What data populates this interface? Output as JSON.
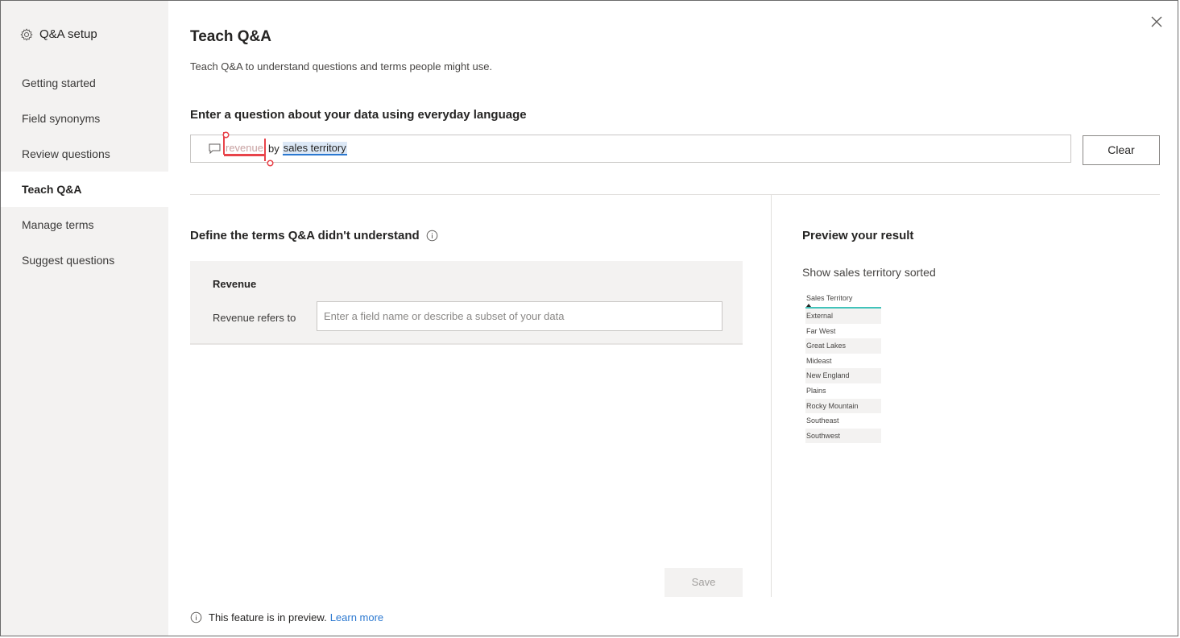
{
  "sidebar": {
    "header": "Q&A setup",
    "items": [
      {
        "label": "Getting started"
      },
      {
        "label": "Field synonyms"
      },
      {
        "label": "Review questions"
      },
      {
        "label": "Teach Q&A",
        "active": true
      },
      {
        "label": "Manage terms"
      },
      {
        "label": "Suggest questions"
      }
    ]
  },
  "main": {
    "title": "Teach Q&A",
    "subtitle": "Teach Q&A to understand questions and terms people might use.",
    "question_label": "Enter a question about your data using everyday language",
    "question": {
      "unknown_term": "revenue",
      "connector": "by",
      "known_term": "sales territory"
    },
    "clear_label": "Clear",
    "define_title": "Define the terms Q&A didn't understand",
    "term": {
      "name": "Revenue",
      "refers_label": "Revenue refers to",
      "input_placeholder": "Enter a field name or describe a subset of your data",
      "input_value": ""
    },
    "save_label": "Save",
    "footer": {
      "text": "This feature is in preview.",
      "link": "Learn more"
    }
  },
  "preview": {
    "title": "Preview your result",
    "caption": "Show sales territory sorted",
    "table": {
      "header": "Sales Territory",
      "rows": [
        "External",
        "Far West",
        "Great Lakes",
        "Mideast",
        "New England",
        "Plains",
        "Rocky Mountain",
        "Southeast",
        "Southwest"
      ]
    }
  },
  "colors": {
    "sidebar_bg": "#f3f2f1",
    "error_underline": "#e8434a",
    "recognized_underline": "#2b78d0",
    "table_header_underline": "#41c3ba",
    "link": "#2b78d0"
  },
  "icons": {
    "settings": "gear-icon",
    "close": "close-icon",
    "question": "speech-bubble-icon",
    "info": "info-icon"
  }
}
